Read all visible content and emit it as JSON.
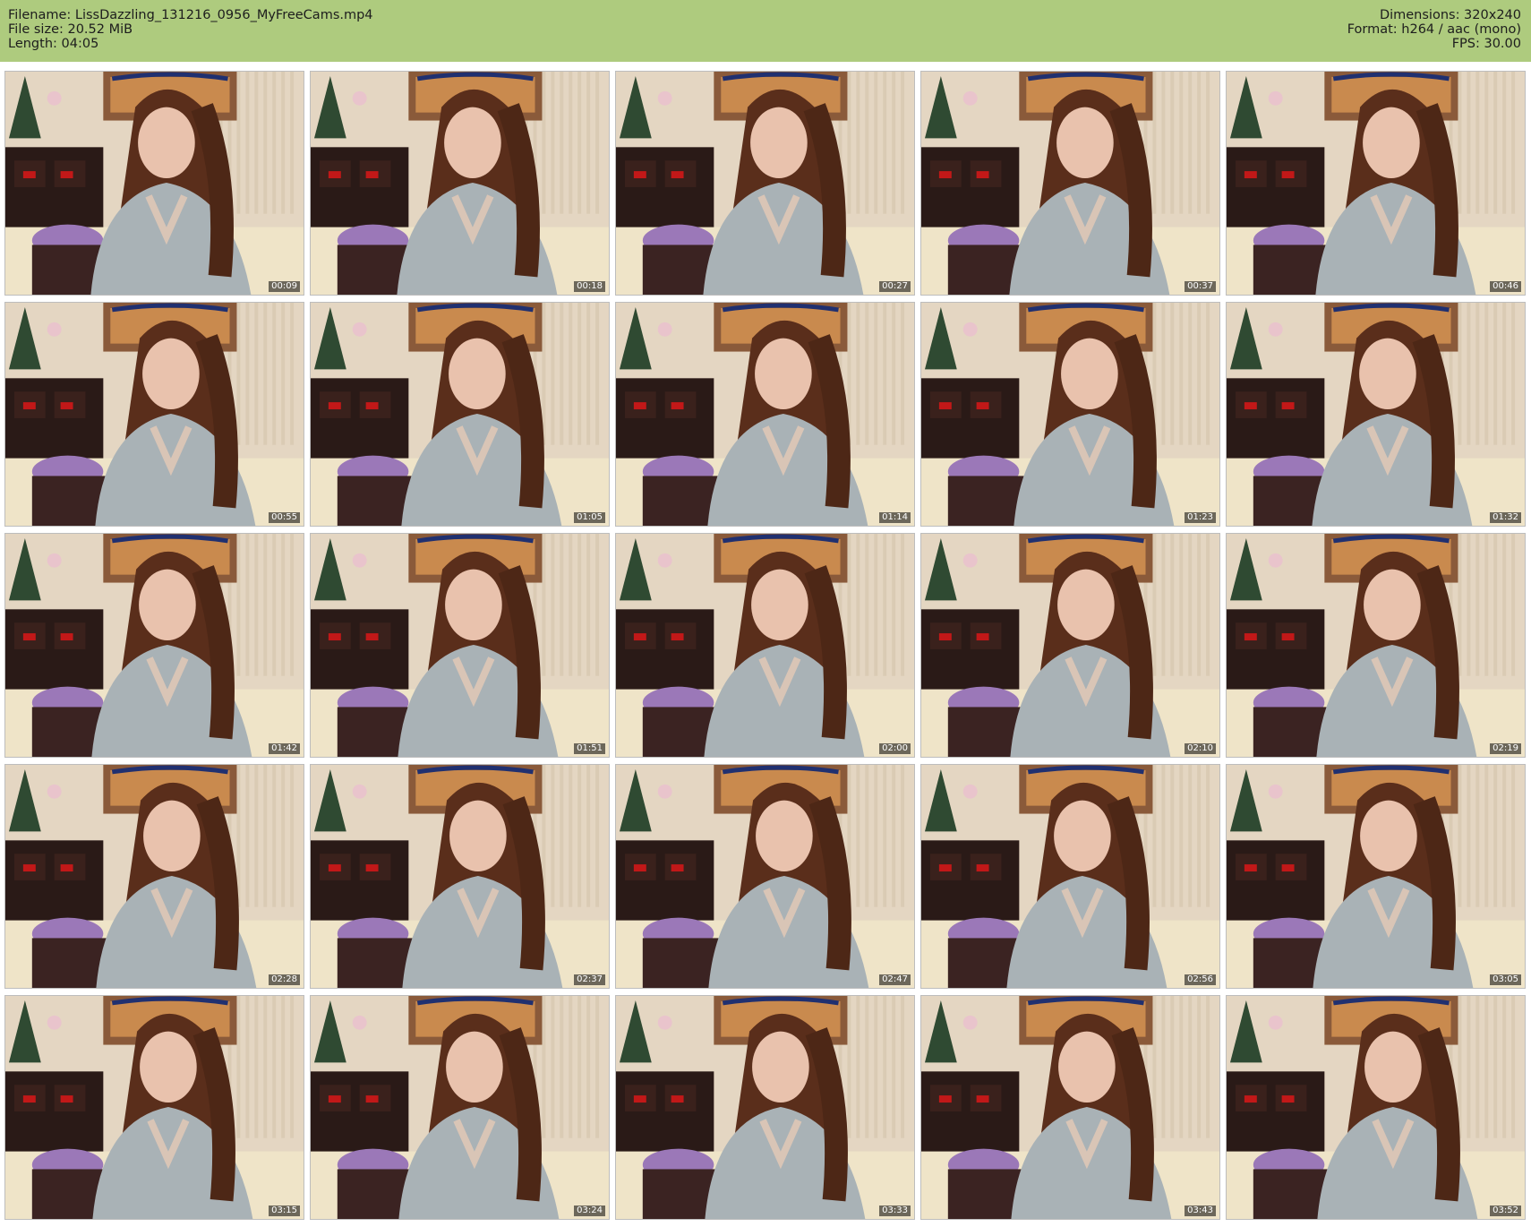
{
  "header": {
    "filename_line": "Filename: LissDazzling_131216_0956_MyFreeCams.mp4",
    "filesize_line": "File size: 20.52 MiB",
    "length_line": "Length: 04:05",
    "dimensions_line": "Dimensions: 320x240",
    "format_line": "Format: h264 / aac (mono)",
    "fps_line": "FPS: 30.00",
    "background_color": "#aecb7e"
  },
  "thumbnails": [
    {
      "timestamp": "00:09"
    },
    {
      "timestamp": "00:18"
    },
    {
      "timestamp": "00:27"
    },
    {
      "timestamp": "00:37"
    },
    {
      "timestamp": "00:46"
    },
    {
      "timestamp": "00:55"
    },
    {
      "timestamp": "01:05"
    },
    {
      "timestamp": "01:14"
    },
    {
      "timestamp": "01:23"
    },
    {
      "timestamp": "01:32"
    },
    {
      "timestamp": "01:42"
    },
    {
      "timestamp": "01:51"
    },
    {
      "timestamp": "02:00"
    },
    {
      "timestamp": "02:10"
    },
    {
      "timestamp": "02:19"
    },
    {
      "timestamp": "02:28"
    },
    {
      "timestamp": "02:37"
    },
    {
      "timestamp": "02:47"
    },
    {
      "timestamp": "02:56"
    },
    {
      "timestamp": "03:05"
    },
    {
      "timestamp": "03:15"
    },
    {
      "timestamp": "03:24"
    },
    {
      "timestamp": "03:33"
    },
    {
      "timestamp": "03:43"
    },
    {
      "timestamp": "03:52"
    }
  ]
}
